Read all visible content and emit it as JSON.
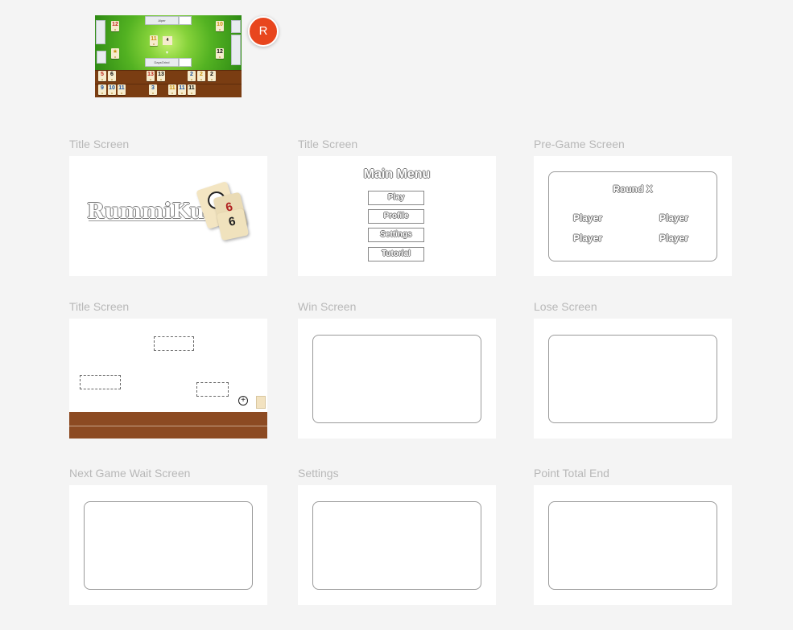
{
  "reference": {
    "player_top": "Alper",
    "player_bottom": "DaysGrind",
    "top_left_tile": "12",
    "top_right_tile": "10",
    "bottom_left_tile": "★",
    "bottom_right_tile": "12",
    "center_tile": "11",
    "center_badge": "4",
    "rack_row1": [
      {
        "n": "5",
        "c": "c-red"
      },
      {
        "n": "6",
        "c": "c-blk"
      },
      {
        "n": "13",
        "c": "c-red"
      },
      {
        "n": "13",
        "c": "c-blk"
      },
      {
        "n": "2",
        "c": "c-blue"
      },
      {
        "n": "2",
        "c": "c-yel"
      },
      {
        "n": "2",
        "c": "c-blk"
      }
    ],
    "rack_row2": [
      {
        "n": "9",
        "c": "c-blue"
      },
      {
        "n": "10",
        "c": "c-blue"
      },
      {
        "n": "11",
        "c": "c-blue"
      },
      {
        "n": "3",
        "c": "c-blue"
      },
      {
        "n": "11",
        "c": "c-yel"
      },
      {
        "n": "11",
        "c": "c-blue"
      },
      {
        "n": "11",
        "c": "c-blk"
      }
    ]
  },
  "user": {
    "avatar_initial": "R",
    "avatar_color": "#e8461e"
  },
  "frames": {
    "f1": {
      "label": "Title Screen",
      "logo": "RummiKub"
    },
    "f2": {
      "label": "Title Screen",
      "heading": "Main Menu",
      "buttons": [
        "Play",
        "Profile",
        "Settings",
        "Tutorial"
      ]
    },
    "f3": {
      "label": "Pre-Game Screen",
      "round": "Round X",
      "players": [
        "Player",
        "Player",
        "Player",
        "Player"
      ]
    },
    "f4": {
      "label": "Title Screen"
    },
    "f5": {
      "label": "Win Screen"
    },
    "f6": {
      "label": "Lose Screen"
    },
    "f7": {
      "label": "Next Game Wait Screen"
    },
    "f8": {
      "label": "Settings"
    },
    "f9": {
      "label": "Point Total End"
    }
  }
}
